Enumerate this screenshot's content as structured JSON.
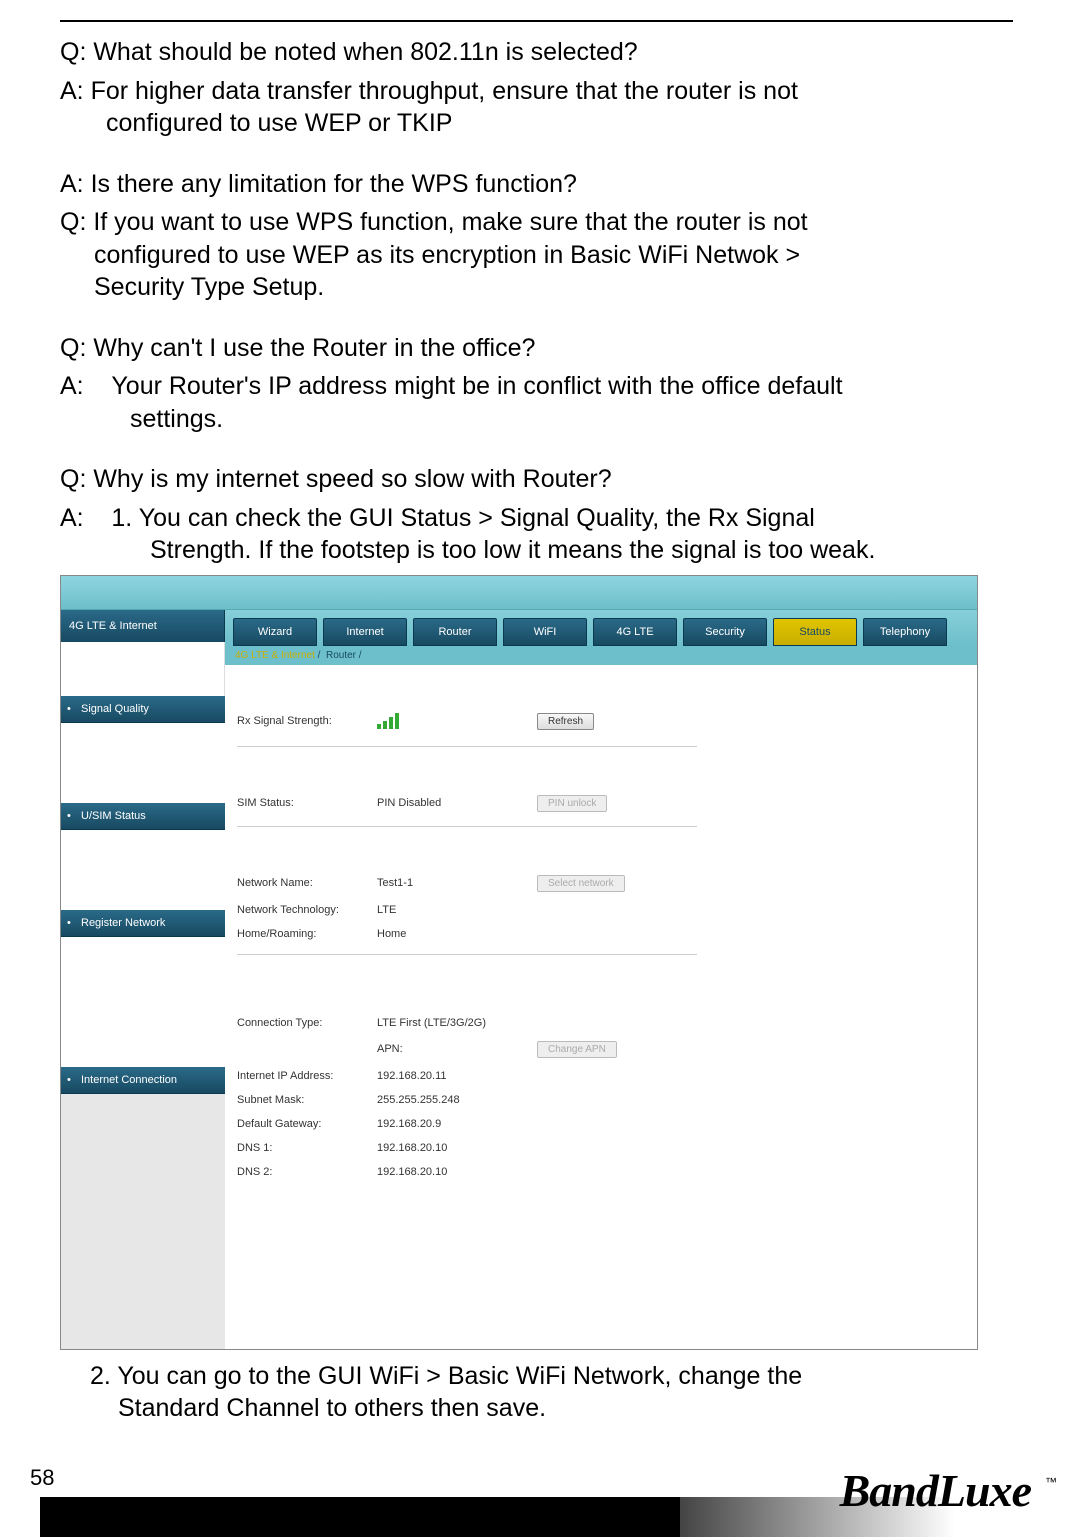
{
  "page_number": "58",
  "brand": "BandLuxe",
  "trademark": "™",
  "faq": [
    {
      "q": "Q: What should be noted when 802.11n is selected?",
      "a": "A: For higher data transfer throughput, ensure that the router is not configured to use WEP or TKIP"
    },
    {
      "q": "A: Is there any limitation for the WPS function?",
      "a": "Q: If you want to use WPS function, make sure that the router is not configured to use WEP as its encryption in Basic WiFi Netwok > Security Type Setup."
    },
    {
      "q": "Q: Why can't I use the Router in the office?",
      "a": "A:    Your Router's IP address might be in conflict with the office default settings."
    },
    {
      "q": "Q: Why is my internet speed so slow with Router?",
      "a": "A:    1. You can check the GUI Status > Signal Quality, the Rx Signal Strength. If the footstep is too low it means the signal is too weak."
    }
  ],
  "answer2": "2. You can go to the GUI WiFi > Basic WiFi Network, change the Standard Channel to others then save.",
  "ui": {
    "brand_tab": "4G LTE & Internet",
    "tabs": [
      "Wizard",
      "Internet",
      "Router",
      "WiFI",
      "4G LTE",
      "Security",
      "Status",
      "Telephony"
    ],
    "active_tab": "Status",
    "breadcrumb_main": "4G LTE & Internet",
    "breadcrumb_sub": "Router",
    "sidebar": [
      "Signal Quality",
      "U/SIM Status",
      "Register Network",
      "Internet Connection"
    ],
    "signal": {
      "label": "Rx Signal Strength:",
      "button": "Refresh"
    },
    "sim": {
      "label": "SIM Status:",
      "value": "PIN Disabled",
      "button": "PIN unlock"
    },
    "network": {
      "name_label": "Network Name:",
      "name_value": "Test1-1",
      "tech_label": "Network Technology:",
      "tech_value": "LTE",
      "roam_label": "Home/Roaming:",
      "roam_value": "Home",
      "button": "Select network"
    },
    "conn": {
      "type_label": "Connection Type:",
      "type_value": "LTE First (LTE/3G/2G)",
      "apn_label": "APN:",
      "apn_button": "Change APN",
      "ip_label": "Internet IP Address:",
      "ip_value": "192.168.20.11",
      "mask_label": "Subnet Mask:",
      "mask_value": "255.255.255.248",
      "gw_label": "Default Gateway:",
      "gw_value": "192.168.20.9",
      "dns1_label": "DNS 1:",
      "dns1_value": "192.168.20.10",
      "dns2_label": "DNS 2:",
      "dns2_value": "192.168.20.10"
    }
  }
}
